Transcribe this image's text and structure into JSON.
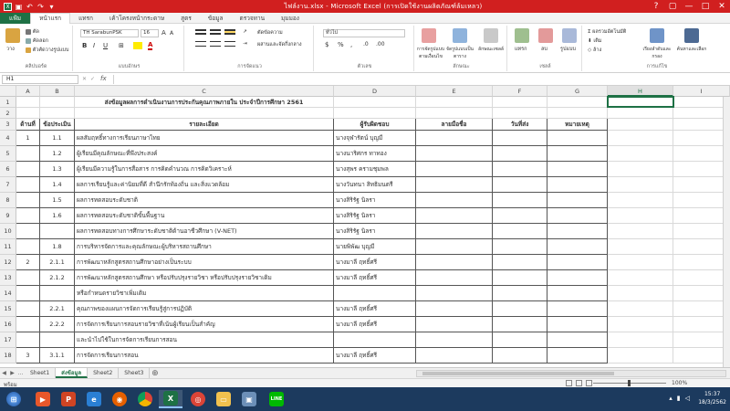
{
  "window": {
    "title": "ไฟล์งาน.xlsx - Microsoft Excel (การเปิดใช้งานผลิตภัณฑ์ล้มเหลว)",
    "controls": [
      "?",
      "▢",
      "—",
      "□",
      "✕"
    ]
  },
  "ribbon_tabs": [
    "แฟ้ม",
    "หน้าแรก",
    "แทรก",
    "เค้าโครงหน้ากระดาษ",
    "สูตร",
    "ข้อมูล",
    "ตรวจทาน",
    "มุมมอง"
  ],
  "ribbon": {
    "clipboard": {
      "paste": "วาง",
      "cut": "ตัด",
      "copy": "คัดลอก",
      "format_painter": "ตัวคัดวางรูปแบบ",
      "label": "คลิปบอร์ด"
    },
    "font": {
      "name": "TH SarabunPSK",
      "size": "16",
      "label": "แบบอักษร"
    },
    "alignment": {
      "wrap": "ตัดข้อความ",
      "merge": "ผสานและจัดกึ่งกลาง",
      "label": "การจัดแนว"
    },
    "number": {
      "format": "ทั่วไป",
      "label": "ตัวเลข"
    },
    "styles": {
      "conditional": "การจัดรูปแบบตามเงื่อนไข",
      "as_table": "จัดรูปแบบเป็นตาราง",
      "cell_styles": "ลักษณะเซลล์",
      "label": "ลักษณะ"
    },
    "cells": {
      "insert": "แทรก",
      "delete": "ลบ",
      "format": "รูปแบบ",
      "label": "เซลล์"
    },
    "editing": {
      "autosum": "ผลรวมอัตโนมัติ",
      "fill": "เติม",
      "clear": "ล้าง",
      "sort": "เรียงลำดับและกรอง",
      "find": "ค้นหาและเลือก",
      "label": "การแก้ไข"
    }
  },
  "formula_bar": {
    "name_box": "H1",
    "fx": "fx",
    "value": ""
  },
  "columns": [
    "A",
    "B",
    "C",
    "D",
    "E",
    "F",
    "G",
    "H",
    "I"
  ],
  "selected_column": "H",
  "rows": [
    {
      "n": "1",
      "a": "",
      "b": "",
      "c": "ส่งข้อมูลผลการดำเนินงานการประกันคุณภาพภายใน ประจำปีการศึกษา 2561",
      "d": "",
      "e": "",
      "f": "",
      "g": ""
    },
    {
      "n": "2",
      "a": "",
      "b": "",
      "c": "",
      "d": "",
      "e": "",
      "f": "",
      "g": ""
    },
    {
      "n": "3",
      "a": "ด้านที่",
      "b": "ข้อประเมิน",
      "c": "รายละเอียด",
      "d": "ผู้รับผิดชอบ",
      "e": "ลายมือชื่อ",
      "f": "วันที่ส่ง",
      "g": "หมายเหตุ"
    },
    {
      "n": "4",
      "a": "1",
      "b": "1.1",
      "c": "ผลสัมฤทธิ์ทางการเรียนภาษาไทย",
      "d": "นางจุฬารัตน์ บุญมี",
      "e": "",
      "f": "",
      "g": ""
    },
    {
      "n": "5",
      "a": "",
      "b": "1.2",
      "c": "ผู้เรียนมีคุณลักษณะที่พึงประสงค์",
      "d": "นางนาริศกร ทาทอง",
      "e": "",
      "f": "",
      "g": ""
    },
    {
      "n": "6",
      "a": "",
      "b": "1.3",
      "c": "ผู้เรียนมีความรู้ในการสื่อสาร การคิดคำนวณ การคิดวิเคราะห์",
      "d": "นางสุพร ครามชุมพล",
      "e": "",
      "f": "",
      "g": ""
    },
    {
      "n": "7",
      "a": "",
      "b": "1.4",
      "c": "ผลการเรียนรู้และค่านิยมที่ดี สำนึกรักท้องถิ่น และสิ่งแวดล้อม",
      "d": "นางวันทนา สิทธิมนตรี",
      "e": "",
      "f": "",
      "g": ""
    },
    {
      "n": "8",
      "a": "",
      "b": "1.5",
      "c": "ผลการทดสอบระดับชาติ",
      "d": "นางสิริรัฐ นิลรา",
      "e": "",
      "f": "",
      "g": ""
    },
    {
      "n": "9",
      "a": "",
      "b": "1.6",
      "c": "ผลการทดสอบระดับชาติขั้นพื้นฐาน",
      "d": "นางสิริรัฐ นิลรา",
      "e": "",
      "f": "",
      "g": ""
    },
    {
      "n": "10",
      "a": "",
      "b": "",
      "c": "ผลการทดสอบทางการศึกษาระดับชาติด้านอาชีวศึกษา (V-NET)",
      "d": "นางสิริรัฐ นิลรา",
      "e": "",
      "f": "",
      "g": ""
    },
    {
      "n": "11",
      "a": "",
      "b": "1.8",
      "c": "การบริหารจัดการและคุณลักษณะผู้บริหารสถานศึกษา",
      "d": "นายพิพัฒ บุญมี",
      "e": "",
      "f": "",
      "g": ""
    },
    {
      "n": "12",
      "a": "2",
      "b": "2.1.1",
      "c": "การพัฒนาหลักสูตรสถานศึกษาอย่างเป็นระบบ",
      "d": "นางมาลี ฤทธิ์ศรี",
      "e": "",
      "f": "",
      "g": ""
    },
    {
      "n": "13",
      "a": "",
      "b": "2.1.2",
      "c": "การพัฒนาหลักสูตรสถานศึกษา หรือปรับปรุงรายวิชา หรือปรับปรุงรายวิชาเดิม",
      "d": "นางมาลี ฤทธิ์ศรี",
      "e": "",
      "f": "",
      "g": ""
    },
    {
      "n": "14",
      "a": "",
      "b": "",
      "c": "หรือกำหนดรายวิชาเพิ่มเติม",
      "d": "",
      "e": "",
      "f": "",
      "g": ""
    },
    {
      "n": "15",
      "a": "",
      "b": "2.2.1",
      "c": "คุณภาพของแผนการจัดการเรียนรู้สู่การปฏิบัติ",
      "d": "นางมาลี ฤทธิ์ศรี",
      "e": "",
      "f": "",
      "g": ""
    },
    {
      "n": "16",
      "a": "",
      "b": "2.2.2",
      "c": "การจัดการเรียนการสอนรายวิชาที่เน้นผู้เรียนเป็นสำคัญ",
      "d": "นางมาลี ฤทธิ์ศรี",
      "e": "",
      "f": "",
      "g": ""
    },
    {
      "n": "17",
      "a": "",
      "b": "",
      "c": "และนำไปใช้ในการจัดการเรียนการสอน",
      "d": "",
      "e": "",
      "f": "",
      "g": ""
    },
    {
      "n": "18",
      "a": "3",
      "b": "3.1.1",
      "c": "การจัดการเรียนการสอน",
      "d": "นางมาลี ฤทธิ์ศรี",
      "e": "",
      "f": "",
      "g": ""
    }
  ],
  "sheets": [
    "Sheet1",
    "ส่งข้อมูล",
    "Sheet2",
    "Sheet3"
  ],
  "active_sheet": "ส่งข้อมูล",
  "status": {
    "mode": "พร้อม",
    "zoom": "100%"
  },
  "clock": {
    "time": "15:37",
    "date": "18/3/2562"
  },
  "colors": {
    "title_red": "#d11f1f",
    "excel_green": "#1e7145",
    "taskbar": "#1c3a5e"
  }
}
